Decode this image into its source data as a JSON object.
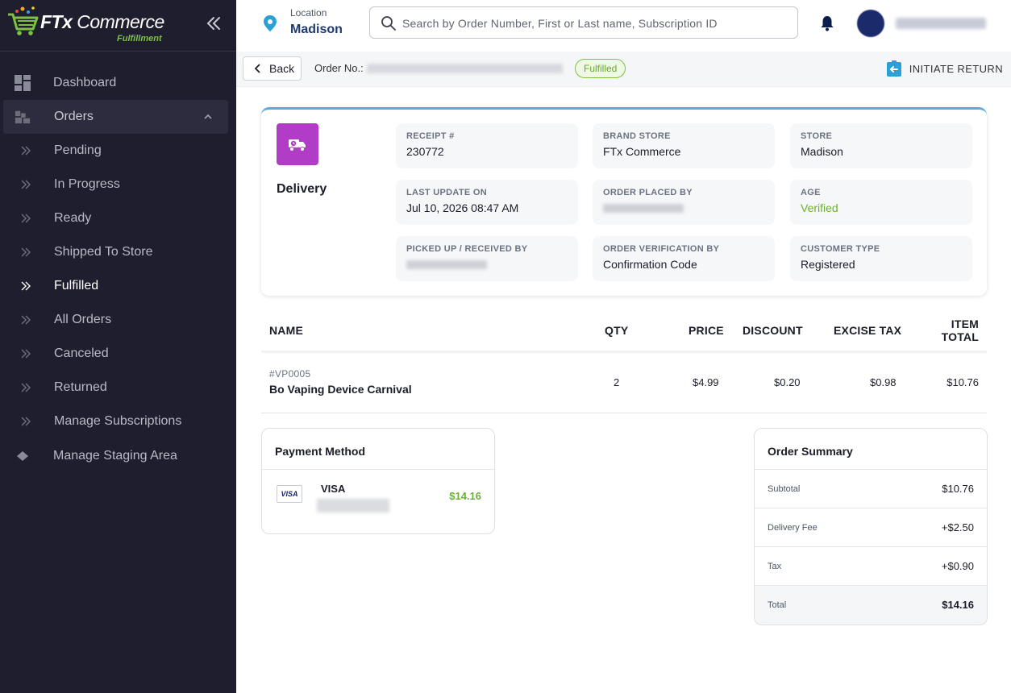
{
  "app": {
    "brand_main": "FTx",
    "brand_second": " Commerce",
    "brand_sub": "Fulfillment"
  },
  "sidebar": {
    "items": [
      {
        "label": "Dashboard",
        "icon": "dashboard-icon"
      },
      {
        "label": "Orders",
        "icon": "orders-icon"
      },
      {
        "label": "Pending",
        "icon": "chevron-right-icon"
      },
      {
        "label": "In Progress",
        "icon": "chevron-right-icon"
      },
      {
        "label": "Ready",
        "icon": "chevron-right-icon"
      },
      {
        "label": "Shipped To Store",
        "icon": "chevron-right-icon"
      },
      {
        "label": "Fulfilled",
        "icon": "chevron-right-icon"
      },
      {
        "label": "All Orders",
        "icon": "chevron-right-icon"
      },
      {
        "label": "Canceled",
        "icon": "chevron-right-icon"
      },
      {
        "label": "Returned",
        "icon": "chevron-right-icon"
      },
      {
        "label": "Manage Subscriptions",
        "icon": "chevron-right-icon"
      },
      {
        "label": "Manage Staging Area",
        "icon": "diamond-icon"
      }
    ]
  },
  "header": {
    "location_label": "Location",
    "location_value": "Madison",
    "search_placeholder": "Search by Order Number, First or Last name, Subscription ID"
  },
  "subheader": {
    "back_label": "Back",
    "order_label": "Order No.:",
    "status": "Fulfilled",
    "initiate_return": "INITIATE RETURN"
  },
  "order": {
    "type": "Delivery",
    "fields": [
      {
        "key": "RECEIPT #",
        "value": "230772"
      },
      {
        "key": "BRAND STORE",
        "value": "FTx Commerce"
      },
      {
        "key": "STORE",
        "value": "Madison"
      },
      {
        "key": "LAST UPDATE ON",
        "value": "Jul 10, 2026 08:47 AM"
      },
      {
        "key": "ORDER PLACED BY",
        "value": ""
      },
      {
        "key": "AGE",
        "value": "Verified"
      },
      {
        "key": "PICKED UP / RECEIVED BY",
        "value": ""
      },
      {
        "key": "ORDER VERIFICATION BY",
        "value": "Confirmation Code"
      },
      {
        "key": "CUSTOMER TYPE",
        "value": "Registered"
      }
    ]
  },
  "items_table": {
    "columns": [
      "NAME",
      "QTY",
      "PRICE",
      "DISCOUNT",
      "EXCISE TAX",
      "ITEM",
      "TOTAL"
    ],
    "rows": [
      {
        "sku": "#VP0005",
        "name": "Bo Vaping Device Carnival",
        "qty": "2",
        "price": "$4.99",
        "discount": "$0.20",
        "excise_tax": "$0.98",
        "item_total": "$10.76"
      }
    ]
  },
  "payment": {
    "title": "Payment Method",
    "card_brand": "VISA",
    "amount": "$14.16"
  },
  "summary": {
    "title": "Order Summary",
    "rows": [
      {
        "label": "Subtotal",
        "value": "$10.76"
      },
      {
        "label": "Delivery Fee",
        "value": "+$2.50"
      },
      {
        "label": "Tax",
        "value": "+$0.90"
      },
      {
        "label": "Total",
        "value": "$14.16"
      }
    ]
  },
  "colors": {
    "sidebar_bg": "#1f1e2e",
    "accent_green": "#7cc242",
    "delivery_purple": "#b13cc5",
    "card_top_border": "#5ba8e0",
    "location_blue": "#2aa0d8"
  }
}
